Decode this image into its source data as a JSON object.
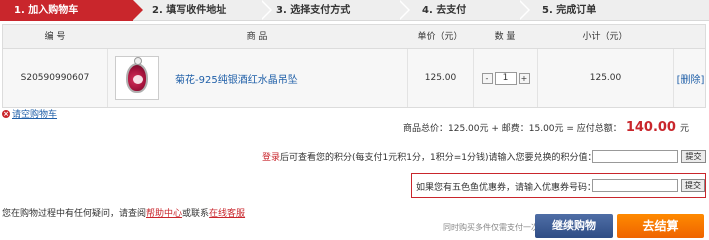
{
  "steps": [
    "1. 加入购物车",
    "2. 填写收件地址",
    "3. 选择支付方式",
    "4. 去支付",
    "5. 完成订单"
  ],
  "table": {
    "headers": {
      "code": "编 号",
      "product": "商 品",
      "unit_price": "单价（元）",
      "quantity": "数 量",
      "subtotal": "小计（元）"
    },
    "rows": [
      {
        "code": "S20590990607",
        "name": "菊花-925纯银酒红水晶吊坠",
        "unit_price": "125.00",
        "quantity": "1",
        "subtotal": "125.00",
        "minus": "-",
        "plus": "+",
        "delete": "[删除]"
      }
    ]
  },
  "clear_cart": "请空购物车",
  "totals": {
    "label": "商品总价：125.00元 + 邮费：15.00元 = 应付总额：",
    "amount": "140.00",
    "unit": "元"
  },
  "points": {
    "login": "登录",
    "text": "后可查看您的积分(每支付1元积1分，1积分=1分钱)请输入您要兑换的积分值：",
    "submit": "提交"
  },
  "coupon": {
    "text": "如果您有五色鱼优惠券，请输入优惠券号码：",
    "submit": "提交"
  },
  "help": {
    "prefix": "您在购物过程中有任何疑问，请查阅",
    "help_link": "帮助中心",
    "middle": "或联系",
    "service_link": "在线客服"
  },
  "bottom": {
    "note": "同时购买多件仅需支付一次邮费",
    "continue": "继续购物",
    "checkout": "去结算"
  }
}
